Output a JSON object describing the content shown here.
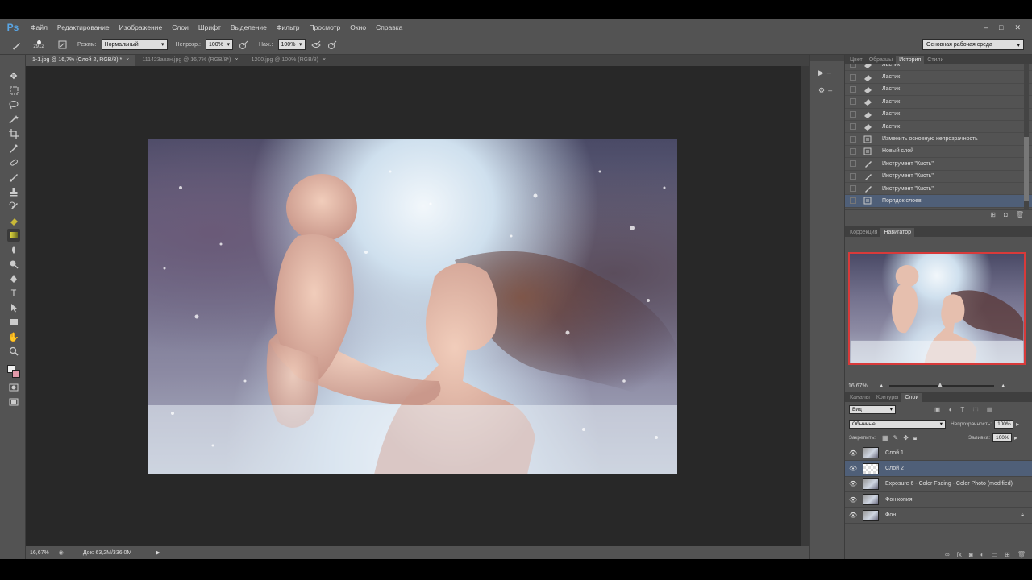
{
  "app": {
    "logo": "Ps"
  },
  "menu": [
    "Файл",
    "Редактирование",
    "Изображение",
    "Слои",
    "Шрифт",
    "Выделение",
    "Фильтр",
    "Просмотр",
    "Окно",
    "Справка"
  ],
  "window_controls": [
    "–",
    "□",
    "✕"
  ],
  "options": {
    "brush_size": "2912",
    "mode_label": "Режим:",
    "mode_value": "Нормальный",
    "opacity_label": "Непрозр.:",
    "opacity_value": "100%",
    "pressure_label": "Наж.:",
    "pressure_value": "100%",
    "workspace": "Основная рабочая среда"
  },
  "tabs": [
    {
      "label": "1-1.jpg @ 16,7% (Слой 2, RGB/8) *",
      "close": "×"
    },
    {
      "label": "111423аван.jpg @ 16,7% (RGB/8*)",
      "close": "×"
    },
    {
      "label": "1200.jpg @ 100% (RGB/8)",
      "close": "×"
    }
  ],
  "status": {
    "zoom": "16,67%",
    "doc": "Док: 63,2M/336,0M"
  },
  "history_panel": {
    "tabs": [
      "Цвет",
      "Образцы",
      "История",
      "Стили"
    ],
    "active_tab": "История",
    "items": [
      {
        "label": "Ластик",
        "icon": "eraser-icon"
      },
      {
        "label": "Ластик",
        "icon": "eraser-icon"
      },
      {
        "label": "Ластик",
        "icon": "eraser-icon"
      },
      {
        "label": "Ластик",
        "icon": "eraser-icon"
      },
      {
        "label": "Ластик",
        "icon": "eraser-icon"
      },
      {
        "label": "Ластик",
        "icon": "eraser-icon"
      },
      {
        "label": "Изменить основную непрозрачность",
        "icon": "document-icon"
      },
      {
        "label": "Новый слой",
        "icon": "document-icon"
      },
      {
        "label": "Инструмент \"Кисть\"",
        "icon": "brush-icon"
      },
      {
        "label": "Инструмент \"Кисть\"",
        "icon": "brush-icon"
      },
      {
        "label": "Инструмент \"Кисть\"",
        "icon": "brush-icon"
      },
      {
        "label": "Порядок слоев",
        "icon": "document-icon"
      }
    ],
    "selected_index": 11
  },
  "navigator_panel": {
    "tabs": [
      "Коррекция",
      "Навигатор"
    ],
    "active_tab": "Навигатор",
    "zoom": "16,67%"
  },
  "layers_panel": {
    "tabs": [
      "Каналы",
      "Контуры",
      "Слои"
    ],
    "active_tab": "Слои",
    "filter": "Вид",
    "blend_mode": "Обычные",
    "opacity_label": "Непрозрачность:",
    "opacity_value": "100%",
    "lock_label": "Закрепить:",
    "fill_label": "Заливка:",
    "fill_value": "100%",
    "layers": [
      {
        "name": "Слой 1",
        "selected": false,
        "locked": false
      },
      {
        "name": "Слой 2",
        "selected": true,
        "locked": false
      },
      {
        "name": "Exposure 6 - Color Fading - Color Photo (modified)",
        "selected": false,
        "locked": false
      },
      {
        "name": "Фон копия",
        "selected": false,
        "locked": false
      },
      {
        "name": "Фон",
        "selected": false,
        "locked": true
      }
    ]
  },
  "colors": {
    "selection": "#4f5f78",
    "navigator_frame": "#d83a3a",
    "logo": "#59a6e6"
  }
}
